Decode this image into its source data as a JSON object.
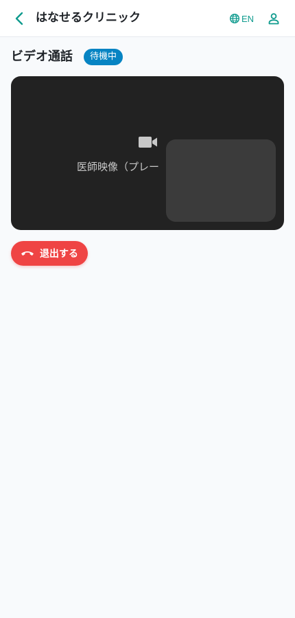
{
  "header": {
    "title": "はなせるクリニック",
    "back_icon": "chevron-left-icon",
    "language_label": "EN",
    "language_icon": "globe-icon",
    "account_icon": "person-icon",
    "accent_color": "#0f9b8e"
  },
  "page": {
    "title": "ビデオ通話",
    "status_badge": "待機中",
    "badge_color": "#0784c3"
  },
  "video": {
    "camera_icon": "video-camera-icon",
    "placeholder_text": "医師映像（プレー"
  },
  "actions": {
    "leave_label": "退出する",
    "leave_icon": "phone-hangup-icon",
    "leave_color": "#ef4444"
  }
}
